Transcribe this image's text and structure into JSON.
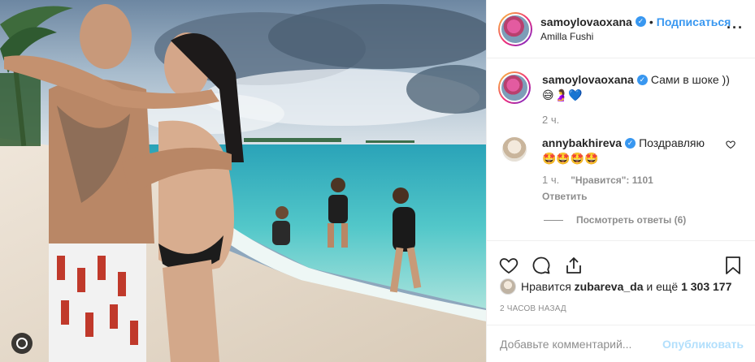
{
  "header": {
    "username": "samoylovaoxana",
    "verified_mark": "✓",
    "separator": "•",
    "follow_label": "Подписаться",
    "location": "Amilla Fushi",
    "more_label": "···"
  },
  "caption": {
    "username": "samoylovaoxana",
    "verified_mark": "✓",
    "text": "Сами в шоке ))",
    "emojis": "😅🤰💙",
    "time": "2 ч."
  },
  "comment": {
    "username": "annybakhireva",
    "verified_mark": "✓",
    "text": "Поздравляю",
    "emojis": "🤩🤩🤩🤩",
    "time": "1 ч.",
    "likes": "\"Нравится\": 1101",
    "reply_label": "Ответить",
    "view_replies_label": "Посмотреть ответы (6)"
  },
  "actions": {
    "like_icon": "heart-icon",
    "comment_icon": "comment-icon",
    "share_icon": "share-icon",
    "save_icon": "bookmark-icon"
  },
  "likes": {
    "prefix": "Нравится",
    "user": "zubareva_da",
    "suffix": "и ещё",
    "count": "1 303 177"
  },
  "posted_ago": "2 ЧАСОВ НАЗАД",
  "add_comment": {
    "placeholder": "Добавьте комментарий...",
    "post_label": "Опубликовать"
  },
  "colors": {
    "accent": "#3897f0",
    "muted": "#8e8e8e",
    "post_disabled": "#b2dffc",
    "text": "#262626"
  }
}
